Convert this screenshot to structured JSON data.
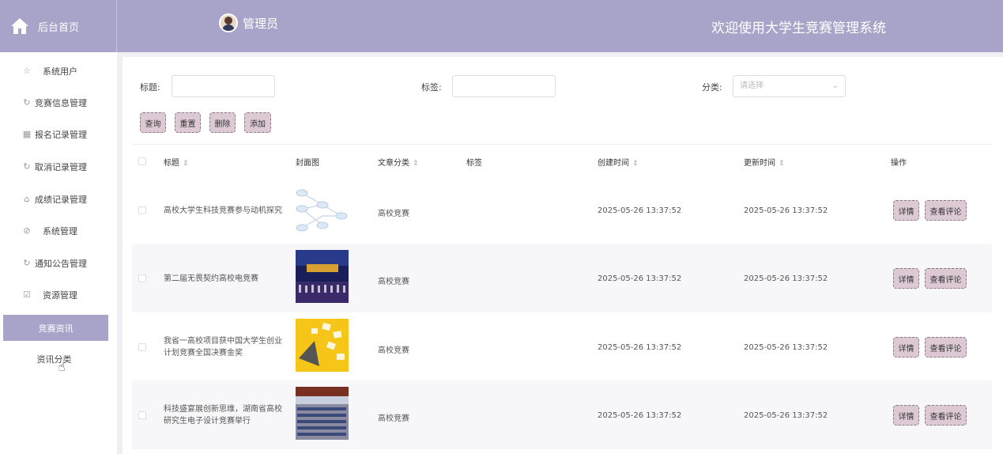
{
  "header": {
    "home_label": "后台首页",
    "admin_label": "管理员",
    "welcome_text": "欢迎使用大学生竞赛管理系统",
    "bg_color": "#a8a3c9"
  },
  "sidebar": {
    "items": [
      {
        "label": "系统用户",
        "icon": "star-outline-icon"
      },
      {
        "label": "竞赛信息管理",
        "icon": "refresh-circle-icon"
      },
      {
        "label": "报名记录管理",
        "icon": "calendar-icon"
      },
      {
        "label": "取消记录管理",
        "icon": "refresh-circle-icon"
      },
      {
        "label": "成绩记录管理",
        "icon": "house-outline-icon"
      },
      {
        "label": "系统管理",
        "icon": "compass-icon"
      },
      {
        "label": "通知公告管理",
        "icon": "refresh-circle-icon"
      },
      {
        "label": "资源管理",
        "icon": "checkbox-icon"
      }
    ],
    "active_group": "竞赛资讯",
    "sub_item": "资讯分类"
  },
  "search": {
    "title_label": "标题:",
    "tag_label": "标签:",
    "category_label": "分类:",
    "category_placeholder": "请选择"
  },
  "toolbar": {
    "query": "查询",
    "reset": "重置",
    "delete": "删除",
    "add": "添加"
  },
  "table": {
    "headers": {
      "title": "标题",
      "cover": "封面图",
      "category": "文章分类",
      "tag": "标签",
      "created": "创建时间",
      "updated": "更新时间",
      "actions": "操作"
    },
    "rows": [
      {
        "title": "高校大学生科技竞赛参与动机探究",
        "category": "高校竞赛",
        "created": "2025-05-26 13:37:52",
        "updated": "2025-05-26 13:37:52",
        "cover": "diagram"
      },
      {
        "title": "第二届无畏契约高校电竞赛",
        "category": "高校竞赛",
        "created": "2025-05-26 13:37:52",
        "updated": "2025-05-26 13:37:52",
        "cover": "stage"
      },
      {
        "title": "我省一高校项目获中国大学生创业计划竞赛全国决赛金奖",
        "category": "高校竞赛",
        "created": "2025-05-26 13:37:52",
        "updated": "2025-05-26 13:37:52",
        "cover": "yellow"
      },
      {
        "title": "科技盛宴展创新思维，湖南省高校研究生电子设计竞赛举行",
        "category": "高校竞赛",
        "created": "2025-05-26 13:37:52",
        "updated": "2025-05-26 13:37:52",
        "cover": "hall"
      }
    ],
    "detail_label": "详情",
    "comments_label": "查看评论"
  }
}
